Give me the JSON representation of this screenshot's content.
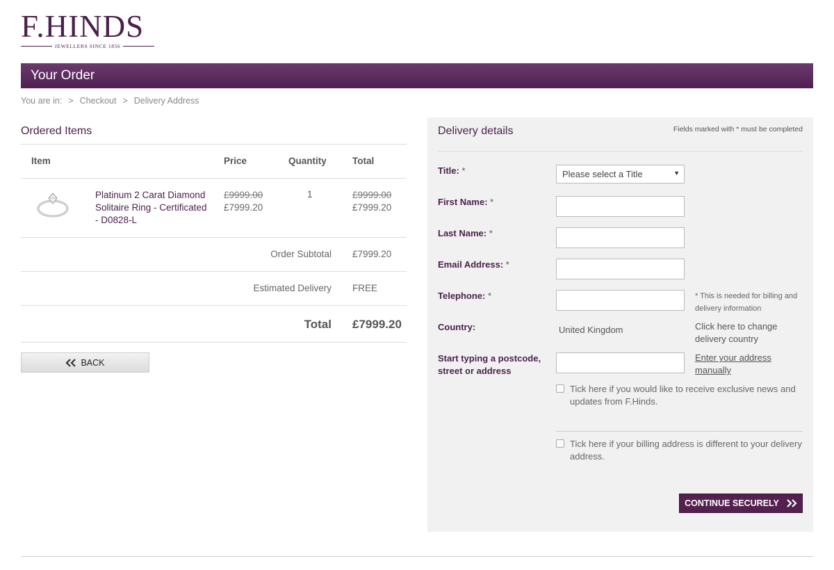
{
  "brand": {
    "name": "F.HINDS",
    "tagline": "JEWELLERS SINCE 1856",
    "color": "#4a1f4b"
  },
  "banner": {
    "title": "Your Order"
  },
  "breadcrumb": {
    "prefix": "You are in:",
    "sep": ">",
    "items": [
      "Checkout",
      "Delivery Address"
    ]
  },
  "ordered": {
    "title": "Ordered Items",
    "columns": {
      "item": "Item",
      "price": "Price",
      "quantity": "Quantity",
      "total": "Total"
    },
    "items": [
      {
        "image_icon": "diamond-ring-icon",
        "name": "Platinum 2 Carat Diamond Solitaire Ring - Certificated - D0828-L",
        "old_price": "£9999.00",
        "price": "£7999.20",
        "quantity": "1",
        "old_total": "£9999.00",
        "total": "£7999.20"
      }
    ],
    "subtotal": {
      "label": "Order Subtotal",
      "value": "£7999.20"
    },
    "delivery": {
      "label": "Estimated Delivery",
      "value": "FREE"
    },
    "total": {
      "label": "Total",
      "value": "£7999.20"
    },
    "back_label": "BACK"
  },
  "delivery_form": {
    "title": "Delivery details",
    "note": "Fields marked with * must be completed",
    "title_field": {
      "label": "Title:",
      "req": "*",
      "selected": "Please select a Title"
    },
    "first_name": {
      "label": "First Name:",
      "req": "*",
      "value": ""
    },
    "last_name": {
      "label": "Last Name:",
      "req": "*",
      "value": ""
    },
    "email": {
      "label": "Email Address:",
      "req": "*",
      "value": ""
    },
    "telephone": {
      "label": "Telephone:",
      "req": "*",
      "value": "",
      "note": "* This is needed for billing and delivery information"
    },
    "country": {
      "label": "Country:",
      "value": "United Kingdom",
      "change_text": "Click here to change delivery country"
    },
    "postcode": {
      "label": "Start typing a postcode, street or address",
      "value": "",
      "manual_link": "Enter your address manually"
    },
    "news_checkbox": {
      "label": "Tick here if you would like to receive exclusive news and updates from F.Hinds.",
      "checked": false
    },
    "billing_checkbox": {
      "label": "Tick here if your billing address is different to your delivery address.",
      "checked": false
    },
    "continue_label": "CONTINUE SECURELY"
  }
}
